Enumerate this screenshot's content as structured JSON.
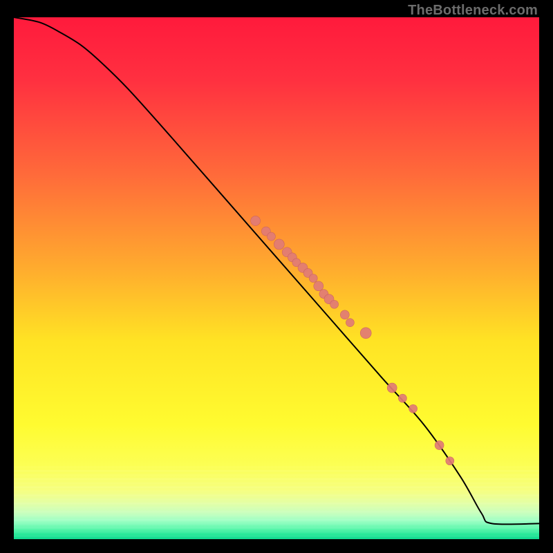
{
  "watermark": "TheBottleneck.com",
  "colors": {
    "gradient_stops": [
      {
        "offset": 0.0,
        "color": "#ff1a3c"
      },
      {
        "offset": 0.12,
        "color": "#ff3040"
      },
      {
        "offset": 0.3,
        "color": "#ff6a3a"
      },
      {
        "offset": 0.48,
        "color": "#ffab2e"
      },
      {
        "offset": 0.62,
        "color": "#ffe324"
      },
      {
        "offset": 0.78,
        "color": "#fffb30"
      },
      {
        "offset": 0.86,
        "color": "#fcff55"
      },
      {
        "offset": 0.907,
        "color": "#f6ff80"
      },
      {
        "offset": 0.93,
        "color": "#e4ffa4"
      },
      {
        "offset": 0.95,
        "color": "#c8ffbe"
      },
      {
        "offset": 0.965,
        "color": "#9dffc4"
      },
      {
        "offset": 0.98,
        "color": "#5cf7ac"
      },
      {
        "offset": 0.992,
        "color": "#23e797"
      },
      {
        "offset": 1.0,
        "color": "#10d98f"
      }
    ],
    "curve": "#000000",
    "marker_fill": "#e17b76",
    "marker_stroke": "#c9635e"
  },
  "chart_data": {
    "type": "line",
    "title": "",
    "xlabel": "",
    "ylabel": "",
    "xlim": [
      0,
      100
    ],
    "ylim": [
      0,
      100
    ],
    "series": [
      {
        "name": "curve",
        "x": [
          0,
          5,
          9,
          13,
          17,
          22,
          30,
          40,
          50,
          60,
          70,
          78,
          85,
          89,
          91,
          100
        ],
        "y": [
          100,
          99,
          97,
          94.5,
          91,
          86,
          77,
          65.5,
          54,
          42.5,
          31,
          22,
          12,
          5,
          3,
          3
        ]
      }
    ],
    "markers": {
      "name": "points",
      "x": [
        46,
        48,
        49,
        50.5,
        52,
        53,
        53.8,
        55,
        56,
        57,
        58,
        59,
        60,
        61,
        63,
        64,
        67,
        72,
        74,
        76,
        81,
        83
      ],
      "y": [
        61,
        59,
        58,
        56.5,
        55,
        54,
        53,
        52,
        51,
        50,
        48.5,
        47,
        46,
        45,
        43,
        41.5,
        39.5,
        29,
        27,
        25,
        18,
        15
      ],
      "r": [
        7,
        6.5,
        6,
        7.5,
        7,
        6.5,
        6,
        7,
        6.5,
        6,
        7,
        6.5,
        7,
        6,
        6.5,
        6,
        8,
        7,
        6,
        6,
        6.5,
        6
      ]
    }
  }
}
